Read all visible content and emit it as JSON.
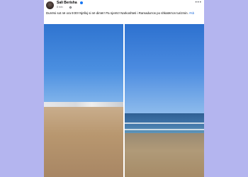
{
  "post": {
    "author": "Sali Berisha",
    "time": "8 min",
    "text": "Durrësi sot në ora 9:00! Njëlloj si në dimër! Pa njerëz! Narkoshteti i Ramadurros po shkatërron turizmin.",
    "hashtag": "#sb",
    "more_menu": "•••"
  },
  "icons": {
    "verified": "verified-badge-icon",
    "globe": "globe-icon"
  },
  "colors": {
    "page_background": "#b3b4ef",
    "link": "#216fdb",
    "verified": "#1877f2"
  }
}
